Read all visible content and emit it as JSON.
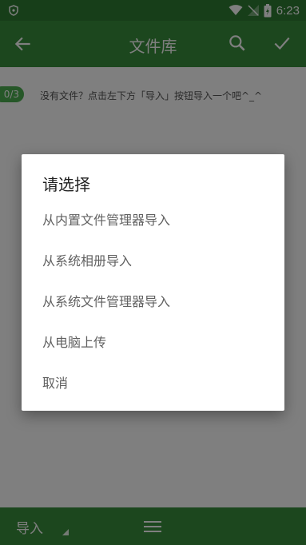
{
  "status_bar": {
    "time": "6:23",
    "icons": [
      "shield-icon",
      "wifi-icon",
      "signal-icon",
      "battery-icon"
    ]
  },
  "app_bar": {
    "title": "文件库",
    "back_icon": "arrow-left-icon",
    "search_icon": "search-icon",
    "confirm_icon": "check-icon"
  },
  "content": {
    "counter": "0/3",
    "hint": "没有文件？点击左下方「导入」按钮导入一个吧^_^"
  },
  "bottom_bar": {
    "import_label": "导入",
    "menu_icon": "menu-icon"
  },
  "dialog": {
    "title": "请选择",
    "options": [
      "从内置文件管理器导入",
      "从系统相册导入",
      "从系统文件管理器导入",
      "从电脑上传",
      "取消"
    ]
  },
  "colors": {
    "status_bar": "#2e7d32",
    "app_bar": "#388e3c",
    "counter_badge": "#4caf50",
    "scrim": "rgba(0,0,0,0.5)"
  }
}
